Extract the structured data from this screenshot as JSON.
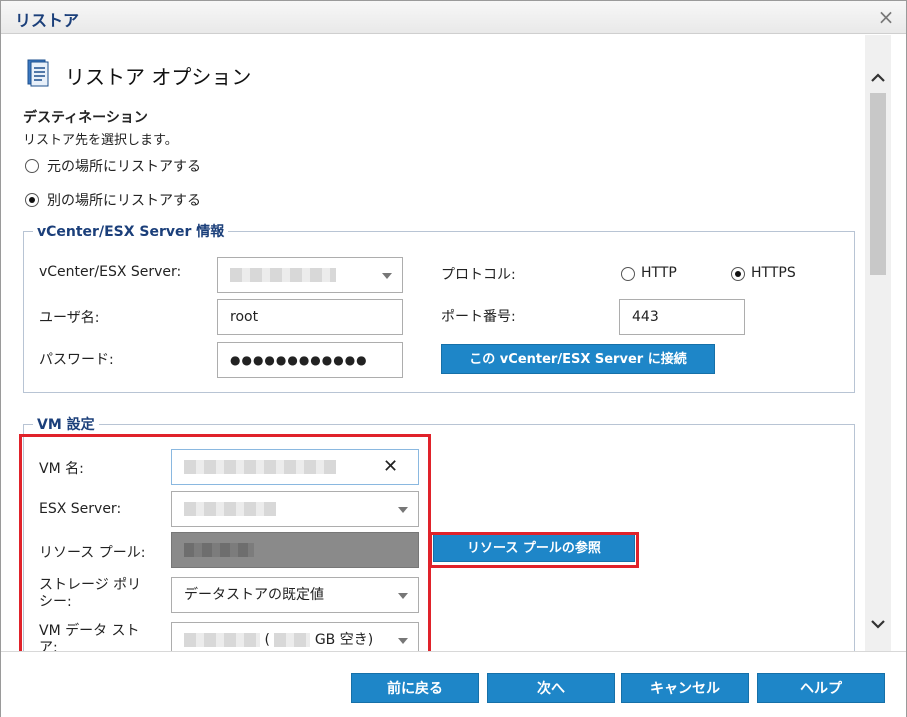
{
  "dialog": {
    "title": "リストア",
    "close_glyph": "×"
  },
  "header": {
    "title": "リストア オプション"
  },
  "destination": {
    "heading": "デスティネーション",
    "description": "リストア先を選択します。",
    "options": [
      {
        "label": "元の場所にリストアする",
        "selected": false
      },
      {
        "label": "別の場所にリストアする",
        "selected": true
      }
    ]
  },
  "vcenter": {
    "group_title": "vCenter/ESX Server 情報",
    "server_label": "vCenter/ESX Server:",
    "user_label": "ユーザ名:",
    "user_value": "root",
    "password_label": "パスワード:",
    "password_value": "●●●●●●●●●●●●",
    "protocol_label": "プロトコル:",
    "protocol_options": [
      {
        "label": "HTTP",
        "selected": false
      },
      {
        "label": "HTTPS",
        "selected": true
      }
    ],
    "port_label": "ポート番号:",
    "port_value": "443",
    "connect_button": "この vCenter/ESX Server に接続"
  },
  "vm": {
    "group_title": "VM 設定",
    "name_label": "VM 名:",
    "clear_glyph": "✕",
    "esx_label": "ESX Server:",
    "resource_pool_label": "リソース プール:",
    "resource_pool_button": "リソース プールの参照",
    "storage_policy_label_1": "ストレージ ポリ",
    "storage_policy_label_2": "シー:",
    "storage_policy_value": "データストアの既定値",
    "datastore_label_1": "VM データ スト",
    "datastore_label_2": "ア:",
    "datastore_value_open": "(",
    "datastore_value_suffix": "GB 空き)"
  },
  "footer": {
    "back": "前に戻る",
    "next": "次へ",
    "cancel": "キャンセル",
    "help": "ヘルプ"
  },
  "colors": {
    "accent": "#1e86c8",
    "title_blue": "#1b3f7a",
    "highlight_red": "#e0222a"
  },
  "icons": {
    "header": "document-icon",
    "scroll_up": "chevron-up-icon",
    "scroll_down": "chevron-down-icon"
  }
}
